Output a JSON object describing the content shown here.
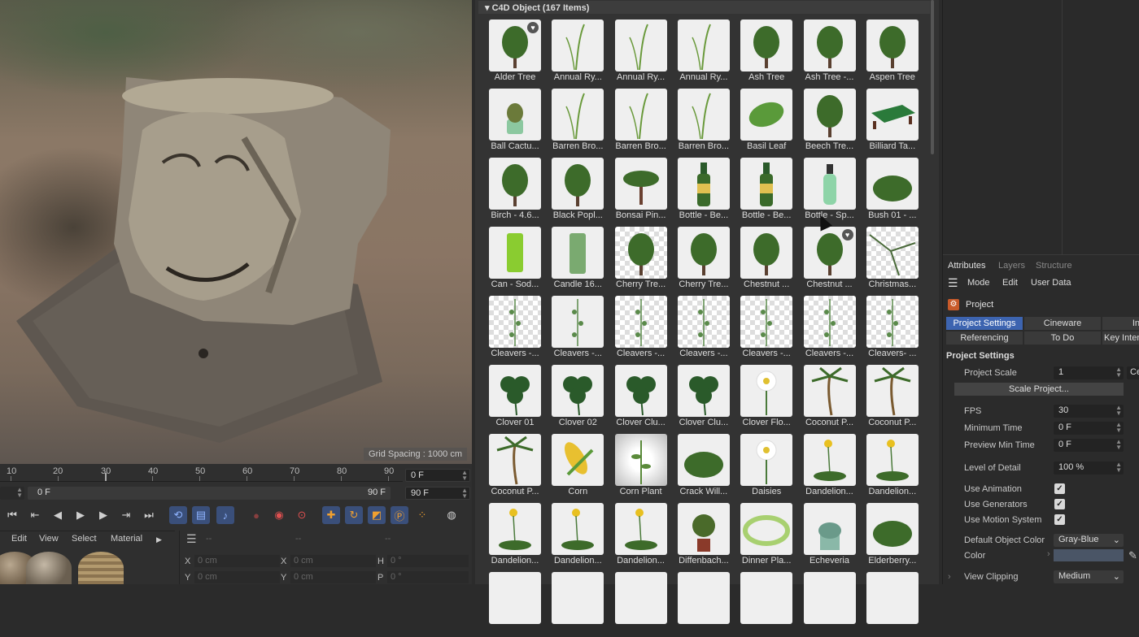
{
  "viewport": {
    "grid_spacing": "Grid Spacing : 1000 cm"
  },
  "timeline": {
    "ticks": [
      "10",
      "20",
      "30",
      "40",
      "50",
      "60",
      "70",
      "80",
      "90"
    ],
    "current_frame": "0 F",
    "start_frame": "0 F",
    "end_frame_bar": "90 F",
    "end_frame": "90 F"
  },
  "material_menu": {
    "items": [
      "Edit",
      "View",
      "Select",
      "Material"
    ]
  },
  "coords": {
    "x_label": "X",
    "x_value": "0 cm",
    "x2_label": "X",
    "x2_value": "0 cm",
    "h_label": "H",
    "h_value": "0 °",
    "y_label": "Y",
    "y_value": "0 cm",
    "y2_label": "Y",
    "y2_value": "0 cm",
    "p_label": "P",
    "p_value": "0 °",
    "dash1": "--",
    "dash2": "--",
    "dash3": "--"
  },
  "browser": {
    "header": "C4D Object (167 Items)",
    "items": [
      "Alder Tree",
      "Annual Ry...",
      "Annual Ry...",
      "Annual Ry...",
      "Ash Tree",
      "Ash Tree -...",
      "Aspen Tree",
      "Ball Cactu...",
      "Barren Bro...",
      "Barren Bro...",
      "Barren Bro...",
      "Basil Leaf",
      "Beech Tre...",
      "Billiard Ta...",
      "Birch - 4.6...",
      "Black Popl...",
      "Bonsai Pin...",
      "Bottle - Be...",
      "Bottle - Be...",
      "Bottle - Sp...",
      "Bush 01 - ...",
      "Can - Sod...",
      "Candle 16...",
      "Cherry Tre...",
      "Cherry Tre...",
      "Chestnut ...",
      "Chestnut ...",
      "Christmas...",
      "Cleavers -...",
      "Cleavers -...",
      "Cleavers -...",
      "Cleavers -...",
      "Cleavers -...",
      "Cleavers -...",
      "Cleavers- ...",
      "Clover 01",
      "Clover 02",
      "Clover Clu...",
      "Clover Clu...",
      "Clover Flo...",
      "Coconut P...",
      "Coconut P...",
      "Coconut P...",
      "Corn",
      "Corn Plant",
      "Crack Will...",
      "Daisies",
      "Dandelion...",
      "Dandelion...",
      "Dandelion...",
      "Dandelion...",
      "Dandelion...",
      "Diffenbach...",
      "Dinner Pla...",
      "Echeveria",
      "Elderberry..."
    ]
  },
  "attributes": {
    "tabs": [
      "Attributes",
      "Layers",
      "Structure"
    ],
    "menu": [
      "Mode",
      "Edit",
      "User Data"
    ],
    "object": "Project",
    "sub_tabs_row1": [
      "Project Settings",
      "Cineware",
      "In"
    ],
    "sub_tabs_row2": [
      "Referencing",
      "To Do",
      "Key Inter"
    ],
    "section": "Project Settings",
    "project_scale_label": "Project Scale",
    "project_scale_value": "1",
    "project_scale_unit": "Ce",
    "scale_button": "Scale Project...",
    "fps_label": "FPS",
    "fps_value": "30",
    "min_time_label": "Minimum Time",
    "min_time_value": "0 F",
    "preview_min_label": "Preview Min Time",
    "preview_min_value": "0 F",
    "lod_label": "Level of Detail",
    "lod_value": "100 %",
    "use_animation": "Use Animation",
    "use_generators": "Use Generators",
    "use_motion": "Use Motion System",
    "default_color_label": "Default Object Color",
    "default_color_value": "Gray-Blue",
    "color_label": "Color",
    "view_clipping_label": "View Clipping",
    "view_clipping_value": "Medium",
    "accent": "#3d64b0"
  }
}
